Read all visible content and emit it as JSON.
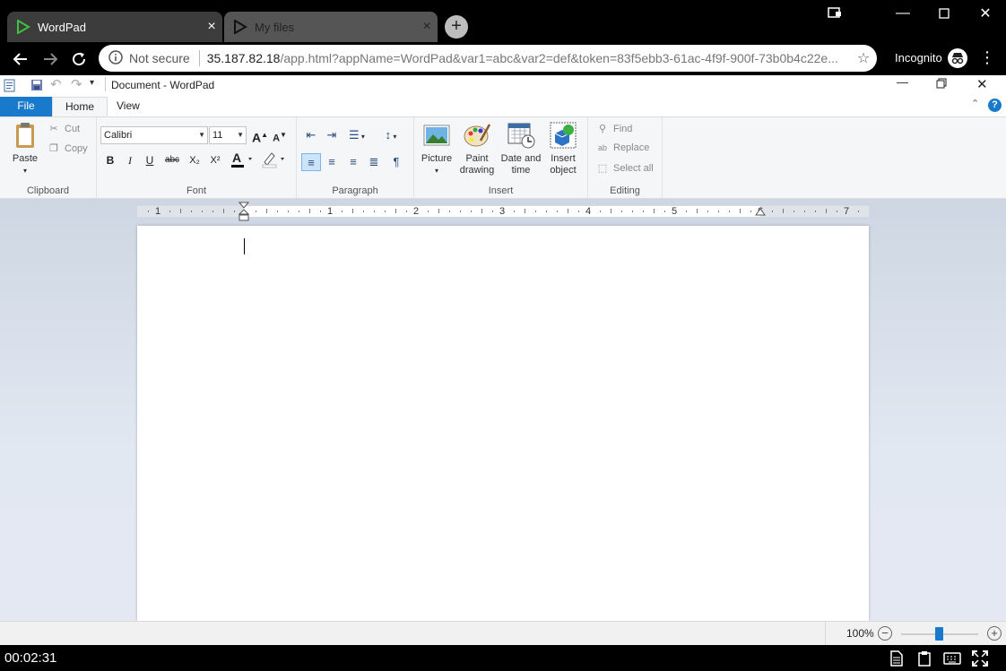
{
  "browser": {
    "tabs": [
      {
        "label": "WordPad",
        "active": true
      },
      {
        "label": "My files",
        "active": false
      }
    ],
    "new_tab": "+",
    "omnibox": {
      "security": "Not secure",
      "url_host": "35.187.82.18",
      "url_rest": "/app.html?appName=WordPad&var1=abc&var2=def&token=83f5ebb3-61ac-4f9f-900f-73b0b4c22e..."
    },
    "profile": "Incognito"
  },
  "wordpad": {
    "title": "Document - WordPad",
    "tabs": {
      "file": "File",
      "home": "Home",
      "view": "View"
    },
    "clipboard": {
      "paste": "Paste",
      "cut": "Cut",
      "copy": "Copy",
      "group": "Clipboard"
    },
    "font": {
      "family": "Calibri",
      "size": "11",
      "group": "Font",
      "bold": "B",
      "italic": "I",
      "underline": "U",
      "strike": "abc",
      "sub": "X₂",
      "sup": "X²"
    },
    "paragraph": {
      "group": "Paragraph"
    },
    "insert": {
      "picture": "Picture",
      "paint": "Paint drawing",
      "datetime": "Date and time",
      "object": "Insert object",
      "group": "Insert"
    },
    "editing": {
      "find": "Find",
      "replace": "Replace",
      "select_all": "Select all",
      "group": "Editing"
    },
    "ruler": [
      "1",
      "1",
      "2",
      "3",
      "4",
      "5",
      "6",
      "7"
    ],
    "zoom": "100%"
  },
  "session": {
    "timer": "00:02:31"
  },
  "colors": {
    "accent": "#1979ca",
    "ribbon_bg": "#f5f6f7",
    "doc_bg": "#d8dfeb"
  }
}
